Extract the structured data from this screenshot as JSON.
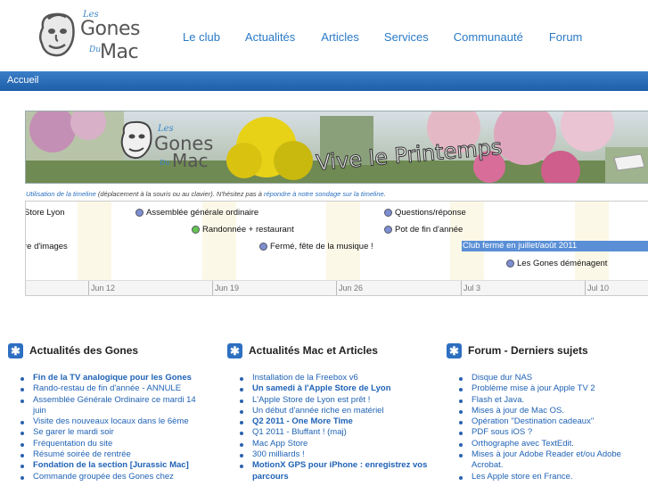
{
  "header": {
    "logo": {
      "les": "Les",
      "gones": "Gones",
      "du": "Du",
      "mac": "Mac"
    },
    "nav": [
      "Le club",
      "Actualités",
      "Articles",
      "Services",
      "Communauté",
      "Forum"
    ]
  },
  "breadcrumb": "Accueil",
  "banner": {
    "les": "Les",
    "gones": "Gones",
    "du": "Du",
    "mac": "Mac",
    "text": "Vive le Printemps"
  },
  "timeline_note": {
    "link1": "Utilisation de la timeline",
    "text1": " (déplacement à la souris ou au clavier). N'hésitez pas à ",
    "link2": "répondre à notre sondage sur la timeline",
    "text2": "."
  },
  "timeline": {
    "events": [
      {
        "label": "Store Lyon",
        "dot": "none"
      },
      {
        "label": "Assemblée générale ordinaire",
        "dot": "blue"
      },
      {
        "label": "Questions/réponse",
        "dot": "blue"
      },
      {
        "label": "Randonnée + restaurant",
        "dot": "green"
      },
      {
        "label": "Pot de fin d'année",
        "dot": "blue"
      },
      {
        "label": "re d'images",
        "dot": "none"
      },
      {
        "label": "Fermé, fête de la musique !",
        "dot": "blue"
      },
      {
        "label": "Les Gones déménagent",
        "dot": "blue"
      }
    ],
    "bar_label": "Club fermé en juillet/août 2011",
    "ticks": [
      "Jun 12",
      "Jun 19",
      "Jun 26",
      "Jul 3",
      "Jul 10"
    ]
  },
  "columns": [
    {
      "title": "Actualités des Gones",
      "items": [
        {
          "text": "Fin de la TV analogique pour les Gones",
          "bold": true
        },
        {
          "text": "Rando-restau de fin d'année - ANNULE",
          "bold": false
        },
        {
          "text": "Assemblée Générale Ordinaire ce mardi 14 juin",
          "bold": false
        },
        {
          "text": "Visite des nouveaux locaux dans le 6ème",
          "bold": false
        },
        {
          "text": "Se garer le mardi soir",
          "bold": false
        },
        {
          "text": "Fréquentation du site",
          "bold": false
        },
        {
          "text": "Résumé soirée de rentrée",
          "bold": false
        },
        {
          "text": "Fondation de la section [Jurassic Mac]",
          "bold": true
        },
        {
          "text": "Commande groupée des Gones chez",
          "bold": false
        }
      ]
    },
    {
      "title": "Actualités Mac et Articles",
      "items": [
        {
          "text": "Installation de la Freebox v6",
          "bold": false
        },
        {
          "text": "Un samedi à l'Apple Store de Lyon",
          "bold": true
        },
        {
          "text": "L'Apple Store de Lyon est prêt !",
          "bold": false
        },
        {
          "text": "Un début d'année riche en matériel",
          "bold": false
        },
        {
          "text": "Q2 2011 - One More Time",
          "bold": true
        },
        {
          "text": "Q1 2011 - Bluffant ! (maj)",
          "bold": false
        },
        {
          "text": "Mac App Store",
          "bold": false
        },
        {
          "text": "300 milliards !",
          "bold": false
        },
        {
          "text": "MotionX GPS pour iPhone : enregistrez vos parcours",
          "bold": true
        }
      ]
    },
    {
      "title": "Forum - Derniers sujets",
      "items": [
        {
          "text": "Disque dur NAS",
          "bold": false
        },
        {
          "text": "Problème mise à jour Apple TV 2",
          "bold": false
        },
        {
          "text": "Flash et Java.",
          "bold": false
        },
        {
          "text": "Mises à jour de Mac OS.",
          "bold": false
        },
        {
          "text": "Opération \"Destination cadeaux\"",
          "bold": false
        },
        {
          "text": "PDF sous iOS ?",
          "bold": false
        },
        {
          "text": "Orthographe avec TextEdit.",
          "bold": false
        },
        {
          "text": "Mises à jour Adobe Reader et/ou Adobe Acrobat.",
          "bold": false
        },
        {
          "text": "Les Apple store en France.",
          "bold": false
        }
      ]
    }
  ]
}
